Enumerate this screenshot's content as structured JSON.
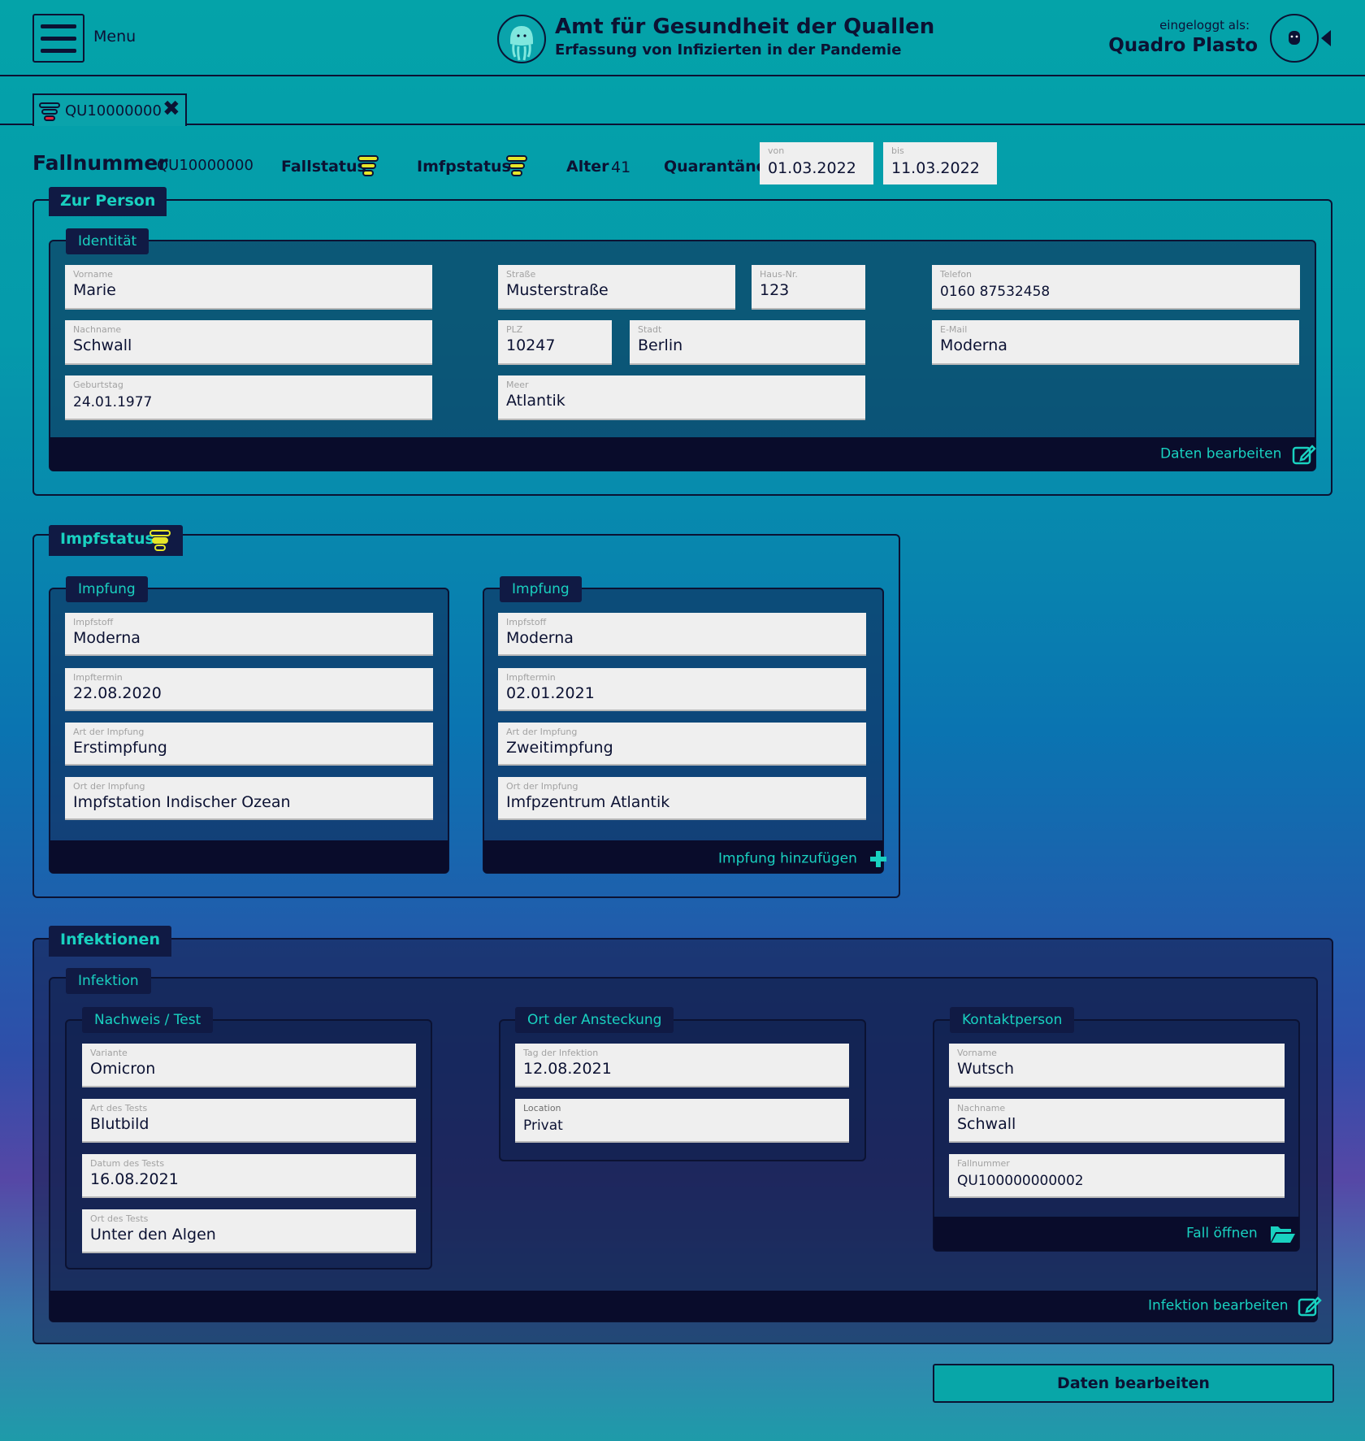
{
  "header": {
    "menu_label": "Menu",
    "title": "Amt für Gesundheit der Quallen",
    "subtitle": "Erfassung von Infizierten in der Pandemie",
    "login_label": "eingeloggt als:",
    "user_name": "Quadro Plasto"
  },
  "tab": {
    "label": "QU10000000"
  },
  "case": {
    "number_label": "Fallnummer",
    "number": "QU10000000",
    "status_label": "Fallstatus",
    "vacc_status_label": "Imfpstatus",
    "age_label": "Alter",
    "age": "41",
    "quarantine_label": "Quarantäne",
    "from_label": "von",
    "from": "01.03.2022",
    "to_label": "bis",
    "to": "11.03.2022"
  },
  "person": {
    "section_title": "Zur Person",
    "group_title": "Identität",
    "fields": {
      "vorname": {
        "label": "Vorname",
        "value": "Marie"
      },
      "nachname": {
        "label": "Nachname",
        "value": "Schwall"
      },
      "geburtstag": {
        "label": "Geburtstag",
        "value": "24.01.1977"
      },
      "strasse": {
        "label": "Straße",
        "value": "Musterstraße"
      },
      "hausnr": {
        "label": "Haus-Nr.",
        "value": "123"
      },
      "plz": {
        "label": "PLZ",
        "value": "10247"
      },
      "stadt": {
        "label": "Stadt",
        "value": "Berlin"
      },
      "meer": {
        "label": "Meer",
        "value": "Atlantik"
      },
      "telefon": {
        "label": "Telefon",
        "value": "0160 87532458"
      },
      "email": {
        "label": "E-Mail",
        "value": "Moderna"
      }
    },
    "edit_label": "Daten bearbeiten"
  },
  "vaccination": {
    "section_title": "Impfstatus",
    "add_label": "Impfung hinzufügen",
    "items": [
      {
        "title": "Impfung",
        "stoff_label": "Impfstoff",
        "stoff": "Moderna",
        "termin_label": "Impftermin",
        "termin": "22.08.2020",
        "art_label": "Art der Impfung",
        "art": "Erstimpfung",
        "ort_label": "Ort der Impfung",
        "ort": "Impfstation Indischer Ozean"
      },
      {
        "title": "Impfung",
        "stoff_label": "Impfstoff",
        "stoff": "Moderna",
        "termin_label": "Impftermin",
        "termin": "02.01.2021",
        "art_label": "Art der Impfung",
        "art": "Zweitimpfung",
        "ort_label": "Ort der Impfung",
        "ort": "Imfpzentrum Atlantik"
      }
    ]
  },
  "infections": {
    "section_title": "Infektionen",
    "group_title": "Infektion",
    "test": {
      "title": "Nachweis / Test",
      "variante_label": "Variante",
      "variante": "Omicron",
      "art_label": "Art des Tests",
      "art": "Blutbild",
      "datum_label": "Datum des Tests",
      "datum": "16.08.2021",
      "ort_label": "Ort des Tests",
      "ort": "Unter den Algen"
    },
    "ansteckung": {
      "title": "Ort der Ansteckung",
      "tag_label": "Tag der Infektion",
      "tag": "12.08.2021",
      "location_label": "Location",
      "location": "Privat"
    },
    "kontakt": {
      "title": "Kontaktperson",
      "vorname_label": "Vorname",
      "vorname": "Wutsch",
      "nachname_label": "Nachname",
      "nachname": "Schwall",
      "fall_label": "Fallnummer",
      "fall": "QU100000000002",
      "open_label": "Fall öffnen"
    },
    "edit_label": "Infektion bearbeiten"
  },
  "bottom_button": "Daten bearbeiten",
  "colors": {
    "accent": "#19d1c0",
    "dark": "#0c1233",
    "panel": "#101a44",
    "status_red": "#e5263a",
    "status_yellow": "#e6e629"
  },
  "icons": [
    "hamburger-icon",
    "jellyfish-logo",
    "avatar-icon",
    "traffic-light-icon",
    "close-icon",
    "edit-icon",
    "plus-icon",
    "folder-open-icon"
  ]
}
